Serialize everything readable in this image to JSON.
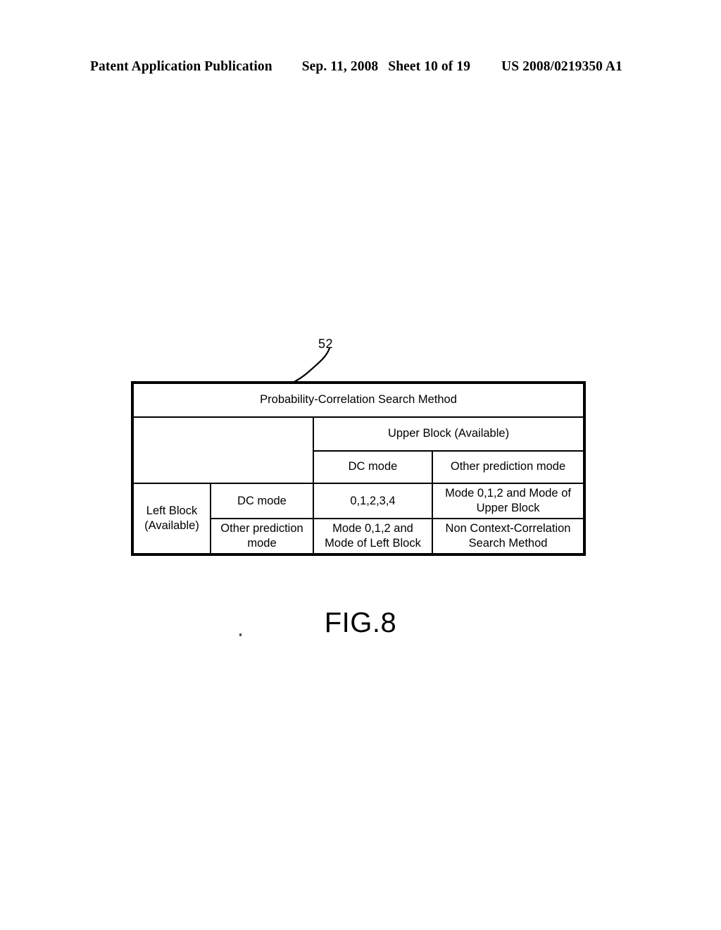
{
  "header": {
    "publication": "Patent Application Publication",
    "date": "Sep. 11, 2008",
    "sheet": "Sheet 10 of 19",
    "patent_number": "US 2008/0219350 A1"
  },
  "figure": {
    "reference_numeral": "52",
    "caption": "FIG.8",
    "table": {
      "title": "Probability-Correlation Search Method",
      "column_group_header": "Upper Block (Available)",
      "column_subheaders": [
        "DC mode",
        "Other prediction mode"
      ],
      "row_group_header": "Left Block (Available)",
      "row_headers": [
        "DC mode",
        "Other prediction mode"
      ],
      "rows": [
        {
          "header": "DC mode",
          "cells": [
            "0,1,2,3,4",
            "Mode 0,1,2 and Mode of Upper Block"
          ]
        },
        {
          "header": "Other prediction mode",
          "cells": [
            "Mode 0,1,2 and Mode of Left Block",
            "Non Context-Correlation Search Method"
          ]
        }
      ]
    }
  }
}
